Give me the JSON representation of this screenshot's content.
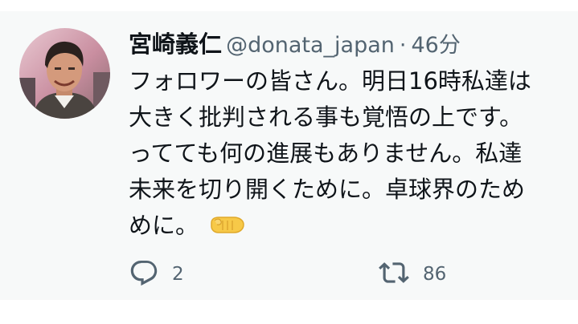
{
  "tweet": {
    "display_name": "宮崎義仁",
    "handle": "@donata_japan",
    "separator": "·",
    "time": "46分",
    "lines": [
      "フォロワーの皆さん。明日16時私達は",
      "大きく批判される事も覚悟の上です。",
      "ってても何の進展もありません。私達",
      "未来を切り開くために。卓球界のため",
      "めに。"
    ],
    "emoji_icon": "fist-emoji-icon",
    "actions": {
      "reply_icon": "reply-icon",
      "reply_count": "2",
      "retweet_icon": "retweet-icon",
      "retweet_count": "86"
    }
  },
  "colors": {
    "background": "#f7f9f9",
    "text": "#0f1419",
    "secondary": "#536471",
    "emoji": "#f7c948"
  }
}
